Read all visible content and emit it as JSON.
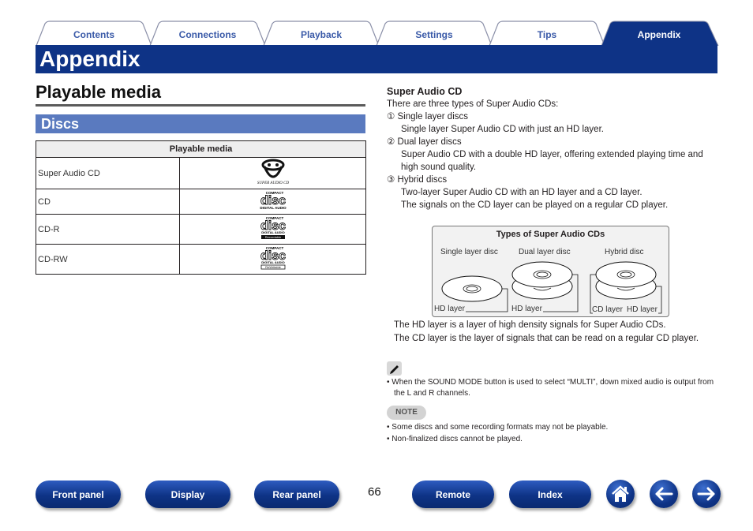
{
  "tabs": [
    {
      "label": "Contents",
      "active": false
    },
    {
      "label": "Connections",
      "active": false
    },
    {
      "label": "Playback",
      "active": false
    },
    {
      "label": "Settings",
      "active": false
    },
    {
      "label": "Tips",
      "active": false
    },
    {
      "label": "Appendix",
      "active": true
    }
  ],
  "banner": {
    "title": "Appendix"
  },
  "section": {
    "title": "Playable media",
    "subtitle": "Discs"
  },
  "media_table": {
    "header": "Playable media",
    "rows": [
      {
        "name": "Super Audio CD",
        "logo": "super-audio-cd-logo",
        "logo_text": "SUPER AUDIO CD"
      },
      {
        "name": "CD",
        "logo": "compact-disc-digital-audio-logo",
        "logo_text": "DIGITAL AUDIO"
      },
      {
        "name": "CD-R",
        "logo": "compact-disc-recordable-logo",
        "logo_text": "Recordable"
      },
      {
        "name": "CD-RW",
        "logo": "compact-disc-rewritable-logo",
        "logo_text": "ReWritable"
      }
    ],
    "logo_compact": "COMPACT",
    "logo_disc": "disc"
  },
  "sacd": {
    "title": "Super Audio CD",
    "intro": "There are three types of Super Audio CDs:",
    "items": [
      {
        "num": "①",
        "label": "Single layer discs",
        "desc": [
          "Single layer Super Audio CD with just an HD layer."
        ]
      },
      {
        "num": "②",
        "label": "Dual layer discs",
        "desc": [
          "Super Audio CD with a double HD layer, offering extended playing time and high sound quality."
        ]
      },
      {
        "num": "③",
        "label": "Hybrid discs",
        "desc": [
          "Two-layer Super Audio CD with an HD layer and a CD layer.",
          "The signals on the CD layer can be played on a regular CD player."
        ]
      }
    ]
  },
  "diagram": {
    "title": "Types of Super Audio CDs",
    "columns": [
      "Single layer disc",
      "Dual layer disc",
      "Hybrid disc"
    ],
    "labels": {
      "single_hd": "HD layer",
      "dual_hd": "HD layer",
      "hybrid_cd": "CD layer",
      "hybrid_hd": "HD layer"
    }
  },
  "explanation": [
    "The HD layer is a layer of high density signals for Super Audio CDs.",
    "The CD layer is the layer of signals that can be read on a regular CD player."
  ],
  "tip": "When the SOUND MODE button is used to select “MULTI”, down mixed audio is output from the L and R channels.",
  "note": {
    "label": "NOTE",
    "items": [
      "Some discs and some recording formats may not be playable.",
      "Non-finalized discs cannot be played."
    ]
  },
  "footer": {
    "buttons": [
      "Front panel",
      "Display",
      "Rear panel",
      "Remote",
      "Index"
    ],
    "page_number": "66",
    "icons": [
      "home-icon",
      "back-arrow-icon",
      "forward-arrow-icon"
    ]
  },
  "colors": {
    "brand_navy": "#0e3386",
    "section_blue": "#5a7abf",
    "tab_text": "#3a5aa8"
  }
}
